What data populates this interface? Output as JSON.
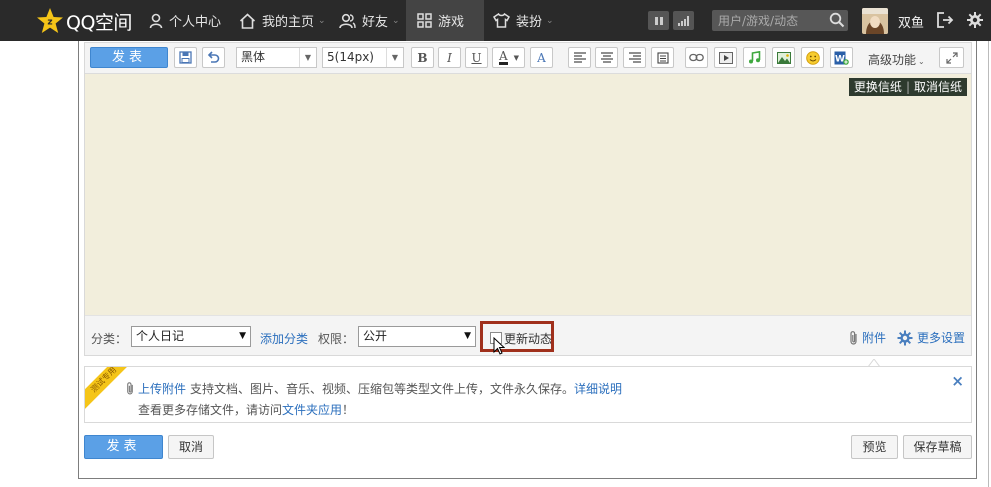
{
  "topbar": {
    "logo_text": "QQ空间",
    "nav": [
      {
        "label": "个人中心",
        "icon": "person-icon"
      },
      {
        "label": "我的主页",
        "icon": "home-icon"
      },
      {
        "label": "好友",
        "icon": "friends-icon"
      },
      {
        "label": "游戏",
        "icon": "grid-icon"
      },
      {
        "label": "装扮",
        "icon": "shirt-icon"
      }
    ],
    "search_placeholder": "用户/游戏/动态",
    "username": "双鱼"
  },
  "toolbar": {
    "publish_label": "发表",
    "font_family": "黑体",
    "font_size": "5(14px)",
    "bold": "B",
    "italic": "I",
    "underline": "U",
    "font_color": "A",
    "font_effect": "A",
    "advanced_label": "高级功能"
  },
  "stationery": {
    "change": "更换信纸",
    "separator": "|",
    "cancel": "取消信纸"
  },
  "options": {
    "category_label": "分类：",
    "category_value": "个人日记",
    "add_category": "添加分类",
    "permission_label": "权限：",
    "permission_value": "公开",
    "update_feed_label": "更新动态",
    "attachment_label": "附件",
    "more_settings_label": "更多设置"
  },
  "notice": {
    "ribbon": "测试专用",
    "upload_link": "上传附件",
    "line1_text": "支持文档、图片、音乐、视频、压缩包等类型文件上传，文件永久保存。",
    "details_link": "详细说明",
    "line2_text": "查看更多存储文件，请访问",
    "folder_link": "文件夹应用",
    "line2_end": "！",
    "close": "×"
  },
  "footer": {
    "publish_label": "发表",
    "cancel_label": "取消",
    "preview_label": "预览",
    "save_draft_label": "保存草稿"
  },
  "colors": {
    "accent_blue": "#5ba0e6",
    "link_blue": "#2b6fbd",
    "highlight_red": "#a0301c",
    "canvas_bg": "#f2eedc",
    "topbar_bg": "#2a2a2a"
  }
}
